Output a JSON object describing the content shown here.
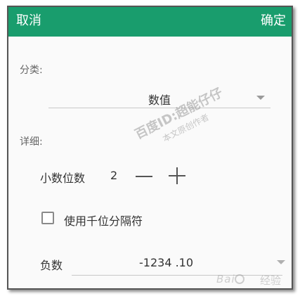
{
  "header": {
    "cancel_label": "取消",
    "confirm_label": "确定",
    "accent_color": "#199d6d"
  },
  "category": {
    "label": "分类:",
    "selected": "数值",
    "icon": "chevron-down-icon"
  },
  "details": {
    "label": "详细:",
    "decimals": {
      "label": "小数位数",
      "value": "2",
      "decrement_icon": "minus-icon",
      "increment_icon": "plus-icon"
    },
    "thousands_separator": {
      "label": "使用千位分隔符",
      "checked": false
    },
    "negative": {
      "label": "负数",
      "selected": "-1234 .10",
      "icon": "chevron-down-icon"
    }
  },
  "watermark": {
    "line1": "百度ID:超能仔仔",
    "line2": "本文原创作者"
  },
  "baidu_watermark": {
    "brand": "Bai",
    "suffix": "经验"
  }
}
